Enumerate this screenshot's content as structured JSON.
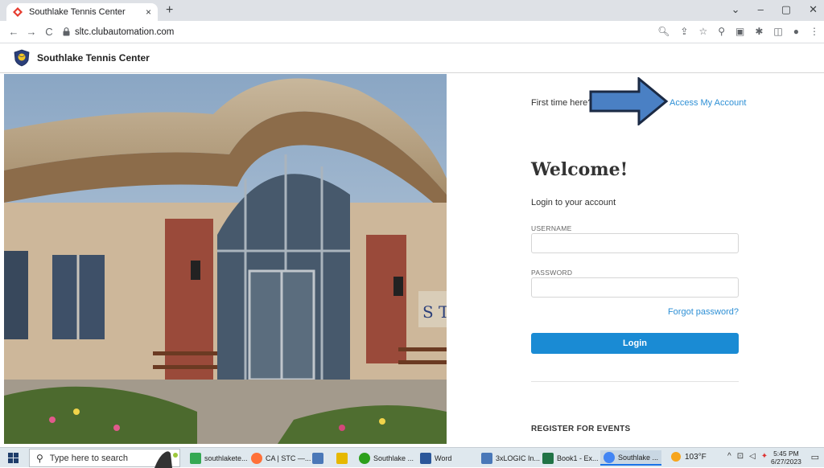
{
  "browser": {
    "tab_title": "Southlake Tennis Center",
    "tab_close": "×",
    "new_tab": "+",
    "url": "sltc.clubautomation.com",
    "back": "←",
    "forward": "→",
    "reload": "C",
    "min": "⌄",
    "minimize": "–",
    "maximize": "▢",
    "close": "✕"
  },
  "site": {
    "name": "Southlake Tennis Center"
  },
  "login": {
    "first_time": "First time here?",
    "access_link": "Access My Account",
    "welcome": "Welcome!",
    "subtitle": "Login to your account",
    "username_label": "USERNAME",
    "username_value": "",
    "password_label": "PASSWORD",
    "password_value": "",
    "forgot": "Forgot password?",
    "login_button": "Login",
    "register_events": "REGISTER FOR EVENTS"
  },
  "photo": {
    "sign_text": "S T"
  },
  "taskbar": {
    "search_placeholder": "Type here to search",
    "apps": [
      {
        "label": "southlakete...",
        "color": "#34a853"
      },
      {
        "label": "CA | STC —...",
        "color": "#ff7139"
      },
      {
        "label": "",
        "color": "#4a78b8"
      },
      {
        "label": "",
        "color": "#e6b800"
      },
      {
        "label": "Southlake ...",
        "color": "#2ca01c"
      },
      {
        "label": "Word",
        "color": "#2b579a"
      },
      {
        "label": "3xLOGIC In...",
        "color": "#4a78b8"
      },
      {
        "label": "Book1 - Ex...",
        "color": "#217346"
      },
      {
        "label": "Southlake ...",
        "color": "#4285f4"
      }
    ],
    "temperature": "103°F",
    "time": "5:45 PM",
    "date": "6/27/2023"
  }
}
